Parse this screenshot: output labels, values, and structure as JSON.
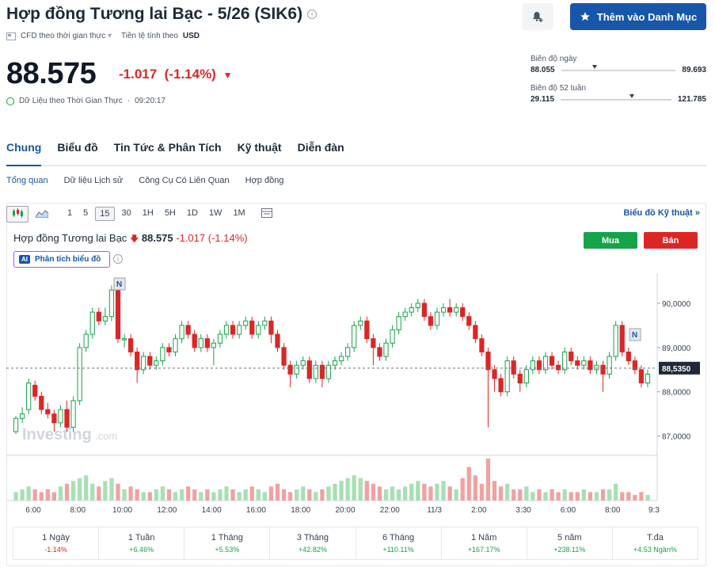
{
  "header": {
    "title": "Hợp đồng Tương lai Bạc - 5/26 (SIK6)",
    "info_icon": "info-icon",
    "bell_icon": "bell-plus-icon",
    "watchlist_label": "Thêm vào Danh Mục",
    "meta_type": "CFD theo thời gian thực",
    "meta_currency_label": "Tiền tệ tính theo",
    "meta_currency": "USD"
  },
  "quote": {
    "price": "88.575",
    "change": "-1.017",
    "change_pct": "(-1.14%)",
    "realtime_label": "Dữ Liệu theo Thời Gian Thực",
    "time": "09:20:17"
  },
  "ranges": {
    "day_label": "Biên độ ngày",
    "day_low": "88.055",
    "day_high": "89.693",
    "day_position": 0.29,
    "week52_label": "Biên độ 52 tuần",
    "week52_low": "29.115",
    "week52_high": "121.785",
    "week52_position": 0.64
  },
  "tabs": [
    "Chung",
    "Biểu đồ",
    "Tin Tức & Phân Tích",
    "Kỹ thuật",
    "Diễn đàn"
  ],
  "subtabs": [
    "Tổng quan",
    "Dữ liệu Lịch sử",
    "Công Cụ Có Liên Quan",
    "Hợp đồng"
  ],
  "toolbar": {
    "intervals": [
      "1",
      "5",
      "15",
      "30",
      "1H",
      "5H",
      "1D",
      "1W",
      "1M"
    ],
    "selected": "15",
    "tech_link": "Biểu đồ Kỹ thuật »"
  },
  "chart_head": {
    "name": "Hợp đồng Tương lai Bạc",
    "price": "88.575",
    "change": "-1.017 (-1.14%)",
    "ai_badge": "AI",
    "ai_label": "Phân tích biểu đồ",
    "buy": "Mua",
    "sell": "Bán"
  },
  "chart_data": {
    "type": "candlestick",
    "watermark": "Investing",
    "watermark_suffix": ".com",
    "y_ticks": [
      "90,0000",
      "89,0000",
      "88,0000",
      "87,0000"
    ],
    "y_tick_values": [
      90,
      89,
      88,
      87
    ],
    "ylim": [
      86.6,
      90.5
    ],
    "current_label": "88,5350",
    "current_value": 88.535,
    "x_ticks": [
      "6:00",
      "8:00",
      "10:00",
      "12:00",
      "14:00",
      "16:00",
      "18:00",
      "20:00",
      "22:00",
      "11/3",
      "2:00",
      "3:30",
      "6:00",
      "8:00",
      "9:3"
    ],
    "news_marker": "N",
    "candles": [
      [
        87.1,
        87.4,
        87.05,
        87.45
      ],
      [
        87.4,
        87.5,
        87.3,
        87.65
      ],
      [
        87.6,
        88.2,
        87.5,
        88.3
      ],
      [
        88.15,
        87.9,
        87.8,
        88.25
      ],
      [
        87.9,
        87.6,
        87.5,
        88.0
      ],
      [
        87.6,
        87.5,
        87.4,
        87.75
      ],
      [
        87.5,
        87.3,
        87.1,
        87.6
      ],
      [
        87.3,
        87.6,
        87.2,
        87.7
      ],
      [
        87.6,
        87.2,
        87.1,
        87.8
      ],
      [
        87.2,
        87.8,
        87.1,
        87.9
      ],
      [
        87.8,
        89.0,
        87.7,
        89.1
      ],
      [
        89.0,
        89.3,
        88.9,
        89.4
      ],
      [
        89.3,
        89.8,
        89.2,
        89.9
      ],
      [
        89.8,
        89.6,
        89.5,
        89.9
      ],
      [
        89.6,
        89.7,
        89.5,
        89.9
      ],
      [
        89.7,
        90.3,
        89.6,
        90.4
      ],
      [
        90.3,
        89.2,
        89.1,
        90.4
      ],
      [
        89.2,
        89.2,
        89.0,
        89.3
      ],
      [
        89.2,
        88.9,
        88.8,
        89.3
      ],
      [
        88.9,
        88.5,
        88.2,
        89.0
      ],
      [
        88.5,
        88.8,
        88.4,
        88.9
      ],
      [
        88.8,
        88.6,
        88.5,
        88.9
      ],
      [
        88.6,
        88.7,
        88.5,
        88.8
      ],
      [
        88.7,
        89.0,
        88.6,
        89.1
      ],
      [
        89.0,
        88.9,
        88.8,
        89.1
      ],
      [
        88.9,
        89.2,
        88.8,
        89.3
      ],
      [
        89.2,
        89.5,
        89.1,
        89.6
      ],
      [
        89.5,
        89.3,
        89.2,
        89.6
      ],
      [
        89.3,
        89.0,
        88.9,
        89.4
      ],
      [
        89.0,
        89.2,
        88.9,
        89.3
      ],
      [
        89.2,
        89.0,
        88.9,
        89.3
      ],
      [
        89.0,
        89.1,
        88.6,
        89.2
      ],
      [
        89.1,
        89.3,
        89.0,
        89.4
      ],
      [
        89.3,
        89.5,
        89.2,
        89.6
      ],
      [
        89.5,
        89.3,
        89.2,
        89.6
      ],
      [
        89.3,
        89.5,
        89.2,
        89.6
      ],
      [
        89.5,
        89.6,
        89.4,
        89.7
      ],
      [
        89.6,
        89.3,
        89.2,
        89.7
      ],
      [
        89.3,
        89.5,
        89.2,
        89.6
      ],
      [
        89.5,
        89.6,
        89.4,
        89.7
      ],
      [
        89.6,
        89.3,
        89.1,
        89.7
      ],
      [
        89.3,
        89.0,
        88.9,
        89.4
      ],
      [
        89.0,
        88.6,
        88.5,
        89.1
      ],
      [
        88.6,
        88.4,
        88.1,
        88.7
      ],
      [
        88.4,
        88.6,
        88.3,
        88.7
      ],
      [
        88.6,
        88.7,
        88.5,
        88.8
      ],
      [
        88.7,
        88.3,
        88.2,
        88.8
      ],
      [
        88.3,
        88.6,
        88.2,
        88.7
      ],
      [
        88.6,
        88.3,
        88.1,
        88.7
      ],
      [
        88.3,
        88.6,
        88.2,
        88.7
      ],
      [
        88.6,
        88.7,
        88.5,
        88.8
      ],
      [
        88.7,
        88.8,
        88.6,
        88.9
      ],
      [
        88.8,
        89.0,
        88.7,
        89.1
      ],
      [
        89.0,
        89.5,
        88.9,
        89.6
      ],
      [
        89.5,
        89.6,
        89.4,
        89.7
      ],
      [
        89.6,
        89.2,
        89.1,
        89.7
      ],
      [
        89.2,
        89.0,
        88.6,
        89.3
      ],
      [
        89.0,
        88.8,
        88.7,
        89.1
      ],
      [
        88.8,
        89.1,
        88.7,
        89.2
      ],
      [
        89.1,
        89.4,
        89.0,
        89.5
      ],
      [
        89.4,
        89.7,
        89.3,
        89.8
      ],
      [
        89.7,
        89.8,
        89.6,
        89.9
      ],
      [
        89.8,
        89.9,
        89.7,
        90.0
      ],
      [
        89.9,
        90.0,
        89.8,
        90.1
      ],
      [
        90.0,
        89.7,
        89.6,
        90.1
      ],
      [
        89.7,
        89.5,
        89.4,
        89.8
      ],
      [
        89.5,
        89.8,
        89.4,
        89.9
      ],
      [
        89.8,
        89.9,
        89.7,
        90.0
      ],
      [
        89.9,
        89.8,
        89.7,
        90.1
      ],
      [
        89.8,
        89.9,
        89.7,
        90.0
      ],
      [
        89.9,
        89.7,
        89.6,
        90.0
      ],
      [
        89.7,
        89.5,
        89.4,
        89.8
      ],
      [
        89.5,
        89.2,
        89.1,
        89.6
      ],
      [
        89.2,
        88.9,
        88.8,
        89.3
      ],
      [
        88.9,
        88.5,
        87.2,
        89.0
      ],
      [
        88.5,
        88.3,
        88.0,
        88.6
      ],
      [
        88.3,
        88.0,
        87.9,
        88.4
      ],
      [
        88.0,
        88.7,
        87.9,
        88.8
      ],
      [
        88.7,
        88.4,
        88.3,
        88.8
      ],
      [
        88.4,
        88.2,
        88.0,
        88.5
      ],
      [
        88.2,
        88.5,
        88.1,
        88.6
      ],
      [
        88.5,
        88.7,
        88.4,
        88.8
      ],
      [
        88.7,
        88.5,
        88.4,
        88.8
      ],
      [
        88.5,
        88.8,
        88.4,
        88.9
      ],
      [
        88.8,
        88.6,
        88.5,
        88.9
      ],
      [
        88.6,
        88.5,
        88.4,
        88.7
      ],
      [
        88.5,
        88.9,
        88.4,
        89.0
      ],
      [
        88.9,
        88.7,
        88.6,
        89.0
      ],
      [
        88.7,
        88.6,
        88.5,
        88.8
      ],
      [
        88.6,
        88.7,
        88.5,
        88.8
      ],
      [
        88.7,
        88.5,
        88.4,
        88.8
      ],
      [
        88.5,
        88.6,
        88.4,
        88.7
      ],
      [
        88.6,
        88.4,
        88.0,
        88.7
      ],
      [
        88.4,
        88.8,
        88.3,
        88.9
      ],
      [
        88.8,
        89.5,
        88.7,
        89.6
      ],
      [
        89.5,
        88.9,
        88.8,
        89.6
      ],
      [
        88.9,
        88.7,
        88.6,
        89.0
      ],
      [
        88.7,
        88.5,
        88.4,
        88.8
      ],
      [
        88.5,
        88.2,
        88.1,
        88.6
      ],
      [
        88.2,
        88.4,
        88.1,
        88.5
      ]
    ],
    "volumes": [
      3,
      4,
      5,
      4,
      3,
      4,
      3,
      5,
      6,
      7,
      8,
      9,
      6,
      5,
      7,
      8,
      6,
      4,
      5,
      4,
      3,
      3,
      4,
      5,
      4,
      3,
      4,
      5,
      4,
      3,
      4,
      3,
      4,
      5,
      4,
      3,
      4,
      5,
      4,
      3,
      5,
      6,
      4,
      3,
      4,
      5,
      4,
      3,
      4,
      5,
      6,
      7,
      8,
      9,
      8,
      7,
      6,
      5,
      4,
      5,
      4,
      5,
      6,
      7,
      6,
      5,
      6,
      7,
      5,
      4,
      8,
      12,
      9,
      6,
      15,
      7,
      5,
      6,
      4,
      4,
      5,
      3,
      4,
      3,
      4,
      3,
      4,
      3,
      3,
      4,
      3,
      3,
      4,
      4,
      6,
      3,
      3,
      2,
      3,
      2
    ],
    "volume_max": 15,
    "volume_colors": {
      "up": "#a7e0b3",
      "down": "#f1a1a1"
    },
    "candle_colors": {
      "up": "#16a34a",
      "down": "#dc2626"
    }
  },
  "performance": [
    {
      "label": "1 Ngày",
      "value": "-1.14%",
      "dir": "down"
    },
    {
      "label": "1 Tuần",
      "value": "+6.46%",
      "dir": "up"
    },
    {
      "label": "1 Tháng",
      "value": "+5.53%",
      "dir": "up"
    },
    {
      "label": "3 Tháng",
      "value": "+42.82%",
      "dir": "up"
    },
    {
      "label": "6 Tháng",
      "value": "+110.11%",
      "dir": "up"
    },
    {
      "label": "1 Năm",
      "value": "+167.17%",
      "dir": "up"
    },
    {
      "label": "5 năm",
      "value": "+238.11%",
      "dir": "up"
    },
    {
      "label": "T.đa",
      "value": "+4.53 Ngàn%",
      "dir": "up"
    }
  ]
}
